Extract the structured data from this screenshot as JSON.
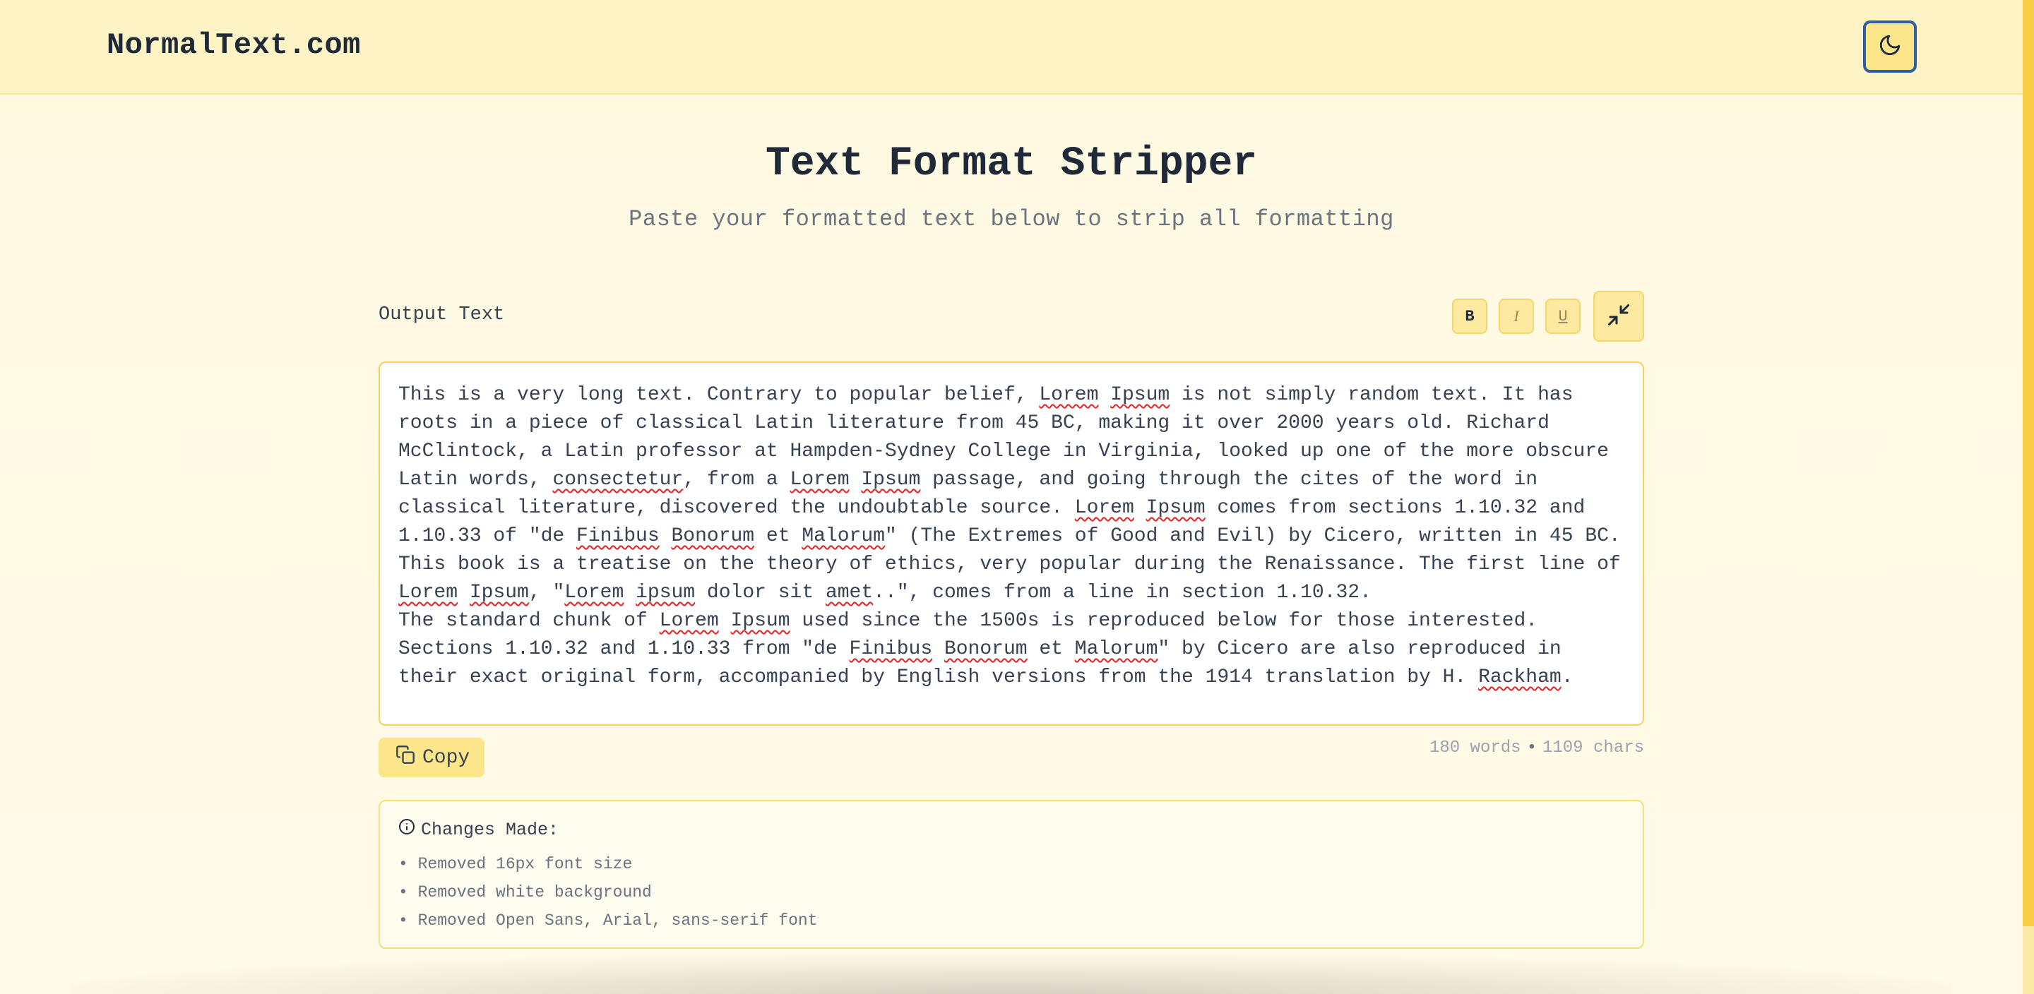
{
  "header": {
    "logo": "NormalText.com",
    "theme_toggle_icon": "moon-icon"
  },
  "main": {
    "title": "Text Format Stripper",
    "subtitle": "Paste your formatted text below to strip all formatting",
    "output_label": "Output Text",
    "format_buttons": {
      "bold": "B",
      "italic": "I",
      "underline": "U"
    },
    "collapse_icon": "minimize-icon",
    "output_text": [
      {
        "t": "This is a very long text. Contrary to popular belief, "
      },
      {
        "t": "Lorem",
        "sp": true
      },
      {
        "t": " "
      },
      {
        "t": "Ipsum",
        "sp": true
      },
      {
        "t": " is not simply random text. It has roots in a piece of classical Latin literature from 45 BC, making it over 2000 years old. Richard McClintock, a Latin professor at Hampden-Sydney College in Virginia, looked up one of the more obscure Latin words, "
      },
      {
        "t": "consectetur",
        "sp": true
      },
      {
        "t": ", from a "
      },
      {
        "t": "Lorem",
        "sp": true
      },
      {
        "t": " "
      },
      {
        "t": "Ipsum",
        "sp": true
      },
      {
        "t": " passage, and going through the cites of the word in classical literature, discovered the undoubtable source. "
      },
      {
        "t": "Lorem",
        "sp": true
      },
      {
        "t": " "
      },
      {
        "t": "Ipsum",
        "sp": true
      },
      {
        "t": " comes from sections 1.10.32 and 1.10.33 of \"de "
      },
      {
        "t": "Finibus",
        "sp": true
      },
      {
        "t": " "
      },
      {
        "t": "Bonorum",
        "sp": true
      },
      {
        "t": " et "
      },
      {
        "t": "Malorum",
        "sp": true
      },
      {
        "t": "\" (The Extremes of Good and Evil) by Cicero, written in 45 BC. This book is a treatise on the theory of ethics, very popular during the Renaissance. The first line of "
      },
      {
        "t": "Lorem",
        "sp": true
      },
      {
        "t": " "
      },
      {
        "t": "Ipsum",
        "sp": true
      },
      {
        "t": ", \""
      },
      {
        "t": "Lorem",
        "sp": true
      },
      {
        "t": " "
      },
      {
        "t": "ipsum",
        "sp": true
      },
      {
        "t": " dolor sit "
      },
      {
        "t": "amet",
        "sp": true
      },
      {
        "t": "..\", comes from a line in section 1.10.32.\nThe standard chunk of "
      },
      {
        "t": "Lorem",
        "sp": true
      },
      {
        "t": " "
      },
      {
        "t": "Ipsum",
        "sp": true
      },
      {
        "t": " used since the 1500s is reproduced below for those interested.\nSections 1.10.32 and 1.10.33 from \"de "
      },
      {
        "t": "Finibus",
        "sp": true
      },
      {
        "t": " "
      },
      {
        "t": "Bonorum",
        "sp": true
      },
      {
        "t": " et "
      },
      {
        "t": "Malorum",
        "sp": true
      },
      {
        "t": "\" by Cicero are also reproduced in their exact original form, accompanied by English versions from the 1914 translation by H. "
      },
      {
        "t": "Rackham",
        "sp": true
      },
      {
        "t": "."
      }
    ],
    "copy_label": "Copy",
    "copy_icon": "copy-icon",
    "stats": {
      "words": "180 words",
      "separator": "•",
      "chars": "1109 chars"
    },
    "changes": {
      "icon": "info-icon",
      "title": "Changes Made:",
      "items": [
        "• Removed 16px font size",
        "• Removed white background",
        "• Removed Open Sans, Arial, sans-serif font"
      ]
    }
  },
  "colors": {
    "header_bg": "#fef3c4",
    "page_bg": "#fef9e4",
    "accent": "#fde68a",
    "border": "#f7d25c",
    "focus_ring": "#2f5ea8",
    "scrollbar_thumb": "#f7cf45"
  }
}
